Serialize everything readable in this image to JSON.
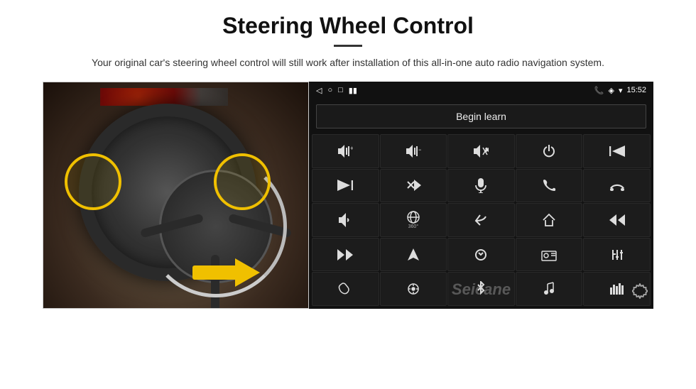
{
  "header": {
    "title": "Steering Wheel Control",
    "subtitle": "Your original car's steering wheel control will still work after installation of this all-in-one auto radio navigation system."
  },
  "status_bar": {
    "time": "15:52",
    "back_icon": "◁",
    "home_icon": "○",
    "square_icon": "□",
    "battery_icon": "▮▮",
    "phone_icon": "📞",
    "location_icon": "◈",
    "wifi_icon": "▾"
  },
  "begin_learn": {
    "label": "Begin learn"
  },
  "controls": [
    {
      "icon": "🔊+",
      "label": "vol-up"
    },
    {
      "icon": "🔊−",
      "label": "vol-down"
    },
    {
      "icon": "🔇",
      "label": "mute"
    },
    {
      "icon": "⏻",
      "label": "power"
    },
    {
      "icon": "⏮",
      "label": "prev-track"
    },
    {
      "icon": "⏭",
      "label": "next"
    },
    {
      "icon": "✂⏭",
      "label": "ffwd"
    },
    {
      "icon": "🎤",
      "label": "mic"
    },
    {
      "icon": "📞",
      "label": "call"
    },
    {
      "icon": "↩",
      "label": "hang-up"
    },
    {
      "icon": "📢",
      "label": "horn"
    },
    {
      "icon": "👁360",
      "label": "360-camera"
    },
    {
      "icon": "↩",
      "label": "back"
    },
    {
      "icon": "🏠",
      "label": "home"
    },
    {
      "icon": "⏮⏮",
      "label": "rewind"
    },
    {
      "icon": "⏭⏭",
      "label": "fast-fwd"
    },
    {
      "icon": "▶",
      "label": "navigate"
    },
    {
      "icon": "⏏",
      "label": "eject"
    },
    {
      "icon": "📻",
      "label": "radio"
    },
    {
      "icon": "≡↕",
      "label": "equalizer"
    },
    {
      "icon": "🎙",
      "label": "record"
    },
    {
      "icon": "⚙",
      "label": "settings2"
    },
    {
      "icon": "✱",
      "label": "bluetooth"
    },
    {
      "icon": "♪",
      "label": "music"
    },
    {
      "icon": "|||",
      "label": "spectrum"
    }
  ],
  "watermark": "Seicane",
  "gear_label": "⚙"
}
